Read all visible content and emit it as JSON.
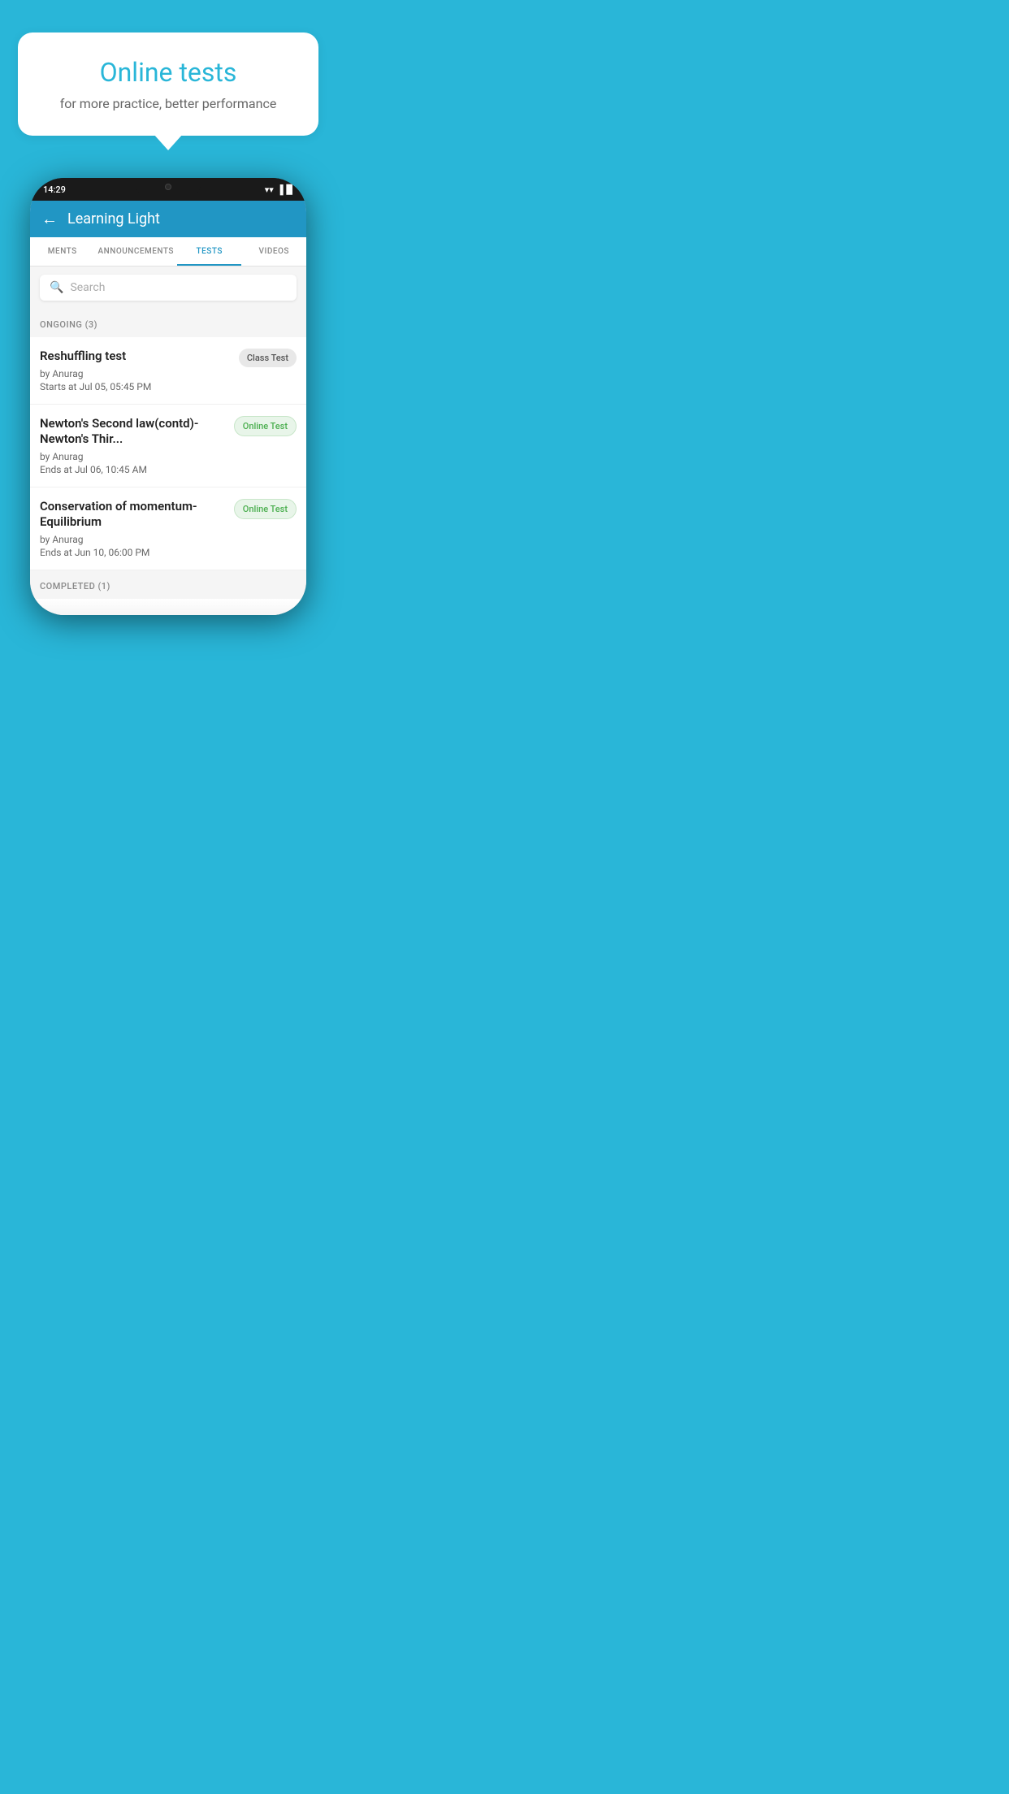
{
  "background_color": "#29b6d8",
  "bubble": {
    "title": "Online tests",
    "subtitle": "for more practice, better performance"
  },
  "phone": {
    "status_time": "14:29",
    "app": {
      "title": "Learning Light",
      "tabs": [
        {
          "label": "MENTS",
          "active": false
        },
        {
          "label": "ANNOUNCEMENTS",
          "active": false
        },
        {
          "label": "TESTS",
          "active": true
        },
        {
          "label": "VIDEOS",
          "active": false
        }
      ],
      "search": {
        "placeholder": "Search"
      },
      "sections": [
        {
          "label": "ONGOING (3)",
          "tests": [
            {
              "title": "Reshuffling test",
              "author": "by Anurag",
              "date": "Starts at  Jul 05, 05:45 PM",
              "badge": "Class Test",
              "badge_type": "class"
            },
            {
              "title": "Newton's Second law(contd)-Newton's Thir...",
              "author": "by Anurag",
              "date": "Ends at  Jul 06, 10:45 AM",
              "badge": "Online Test",
              "badge_type": "online"
            },
            {
              "title": "Conservation of momentum-Equilibrium",
              "author": "by Anurag",
              "date": "Ends at  Jun 10, 06:00 PM",
              "badge": "Online Test",
              "badge_type": "online"
            }
          ]
        }
      ],
      "completed_label": "COMPLETED (1)"
    }
  }
}
